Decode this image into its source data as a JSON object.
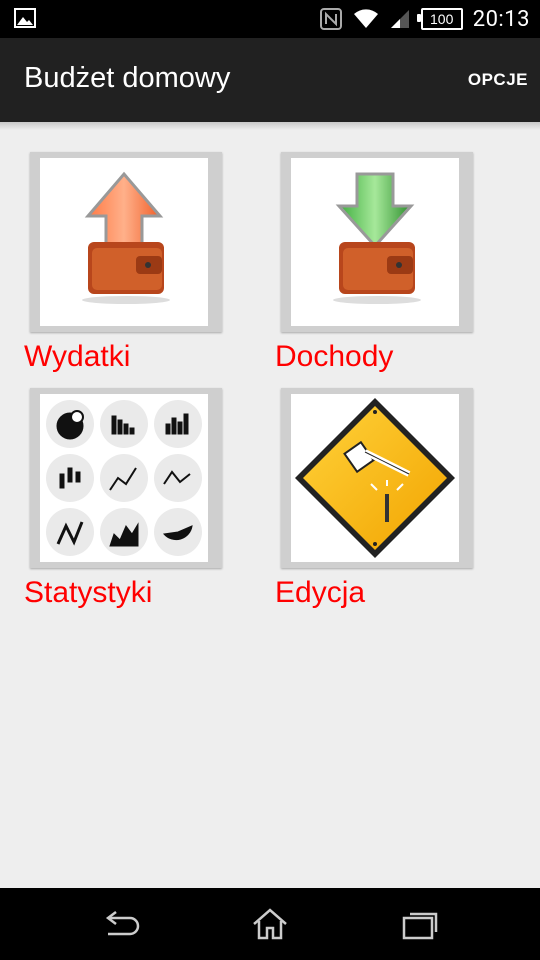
{
  "status_bar": {
    "time": "20:13",
    "battery": "100",
    "icons": [
      "image-notification-icon",
      "nfc-icon",
      "wifi-icon",
      "signal-icon",
      "battery-icon"
    ]
  },
  "action_bar": {
    "title": "Budżet domowy",
    "menu_label": "OPCJE"
  },
  "tiles": [
    {
      "label": "Wydatki",
      "icon": "wallet-up-arrow-icon"
    },
    {
      "label": "Dochody",
      "icon": "wallet-down-arrow-icon"
    },
    {
      "label": "Statystyki",
      "icon": "charts-grid-icon"
    },
    {
      "label": "Edycja",
      "icon": "hammer-warning-sign-icon"
    }
  ],
  "nav_bar": {
    "buttons": [
      "back-icon",
      "home-icon",
      "recent-apps-icon"
    ]
  },
  "colors": {
    "label": "#ff0000",
    "action_bar": "#212121",
    "background": "#eeeeee"
  }
}
